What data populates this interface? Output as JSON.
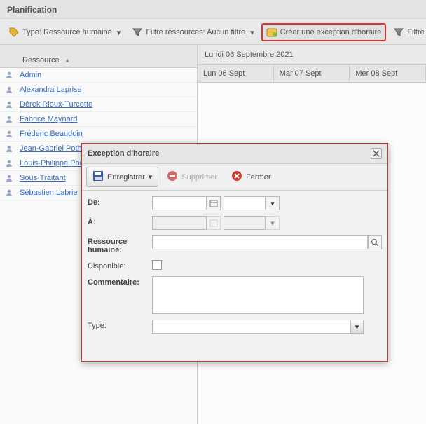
{
  "header": {
    "title": "Planification"
  },
  "toolbar": {
    "type_tool": "Type: Ressource humaine",
    "filter_res": "Filtre ressources: Aucun filtre",
    "create_exception": "Créer une exception d'horaire",
    "filter_tasks": "Filtre tâches: Au"
  },
  "left": {
    "col_header": "Ressource",
    "items": [
      {
        "name": "Admin"
      },
      {
        "name": "Alexandra Laprise"
      },
      {
        "name": "Dérek Rioux-Turcotte"
      },
      {
        "name": "Fabrice Maynard"
      },
      {
        "name": "Fréderic Beaudoin"
      },
      {
        "name": "Jean-Gabriel Poth"
      },
      {
        "name": "Louis-Philippe Pou"
      },
      {
        "name": "Sous-Traitant"
      },
      {
        "name": "Sébastien Labrie"
      }
    ]
  },
  "right": {
    "week_title": "Lundi 06 Septembre 2021",
    "days": [
      "Lun 06 Sept",
      "Mar 07 Sept",
      "Mer 08 Sept"
    ]
  },
  "dialog": {
    "title": "Exception d'horaire",
    "save": "Enregistrer",
    "delete": "Supprimer",
    "close": "Fermer",
    "labels": {
      "from": "De:",
      "to": "À:",
      "resource": "Ressource humaine:",
      "available": "Disponible:",
      "comment": "Commentaire:",
      "type": "Type:"
    }
  }
}
